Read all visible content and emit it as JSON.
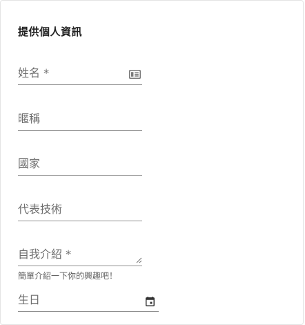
{
  "form": {
    "title": "提供個人資訊",
    "fields": {
      "name": {
        "label": "姓名 *",
        "icon": "contact-card-icon"
      },
      "nickname": {
        "label": "暱稱"
      },
      "country": {
        "label": "國家"
      },
      "representative_skill": {
        "label": "代表技術"
      },
      "bio": {
        "label": "自我介紹 *",
        "icon": "resize-handle-icon",
        "helper": "簡單介紹一下你的興趣吧！"
      },
      "birthday": {
        "label": "生日",
        "icon": "calendar-icon"
      }
    }
  }
}
